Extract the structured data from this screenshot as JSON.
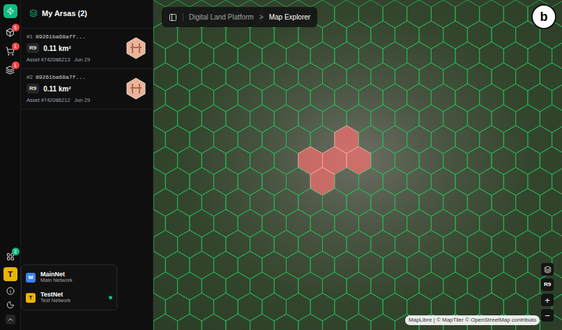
{
  "breadcrumb": {
    "items": [
      "Digital Land Platform",
      "Map Explorer"
    ],
    "separator": ">"
  },
  "rail": {
    "top_items": [
      {
        "badge": "5"
      },
      {
        "badge": "1"
      },
      {
        "badge": "1"
      }
    ],
    "apps_badge": "2",
    "avatar": "T"
  },
  "panel": {
    "title": "My Arsas (2)",
    "items": [
      {
        "index": "#1",
        "id": "89261ba68aff...",
        "resolution": "R9",
        "area": "0.11 km²",
        "asset": "Asset #742086213",
        "date": "Jun 29"
      },
      {
        "index": "#2",
        "id": "89261ba68a7f...",
        "resolution": "R9",
        "area": "0.11 km²",
        "asset": "Asset #742086212",
        "date": "Jun 29"
      }
    ]
  },
  "networks": [
    {
      "badge": "M",
      "name": "MainNet",
      "description": "Main Network",
      "color": "#3b82f6",
      "selected": false
    },
    {
      "badge": "T",
      "name": "TestNet",
      "description": "Test Network",
      "color": "#eab308",
      "selected": true
    }
  ],
  "map": {
    "logo": "b",
    "resolution": "R9",
    "zoom_in": "+",
    "zoom_out": "−",
    "attribution": "MapLibre | © MapTiler © OpenStreetMap contributo",
    "highlighted_cells": [
      [
        8,
        6
      ],
      [
        6,
        7
      ],
      [
        7,
        7
      ],
      [
        8,
        7
      ],
      [
        7,
        8
      ]
    ]
  }
}
